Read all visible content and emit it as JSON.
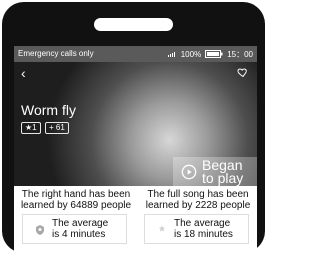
{
  "status_bar": {
    "carrier": "Emergency calls only",
    "battery": "100%",
    "time": "15：00"
  },
  "song": {
    "title": "Worm fly",
    "badges": [
      "★1",
      "+ 61"
    ],
    "play_label_line1": "Began",
    "play_label_line2": "to play"
  },
  "stats": {
    "left": {
      "line1": "The right hand has been",
      "line2": "learned by 64889 people",
      "avg1": "The average",
      "avg2": "is 4 minutes"
    },
    "right": {
      "line1": "The full song has been",
      "line2": "learned by 2228 people",
      "avg1": "The average",
      "avg2": "is 18 minutes"
    }
  },
  "icons": {
    "back": "chevron-left-icon",
    "heart": "heart-icon",
    "play": "play-icon",
    "clock": "clock-icon",
    "signal": "signal-icon",
    "battery": "battery-icon"
  },
  "colors": {
    "device": "#111111",
    "status_bar": "#5a5a5a",
    "overlay": "#ffffff"
  }
}
